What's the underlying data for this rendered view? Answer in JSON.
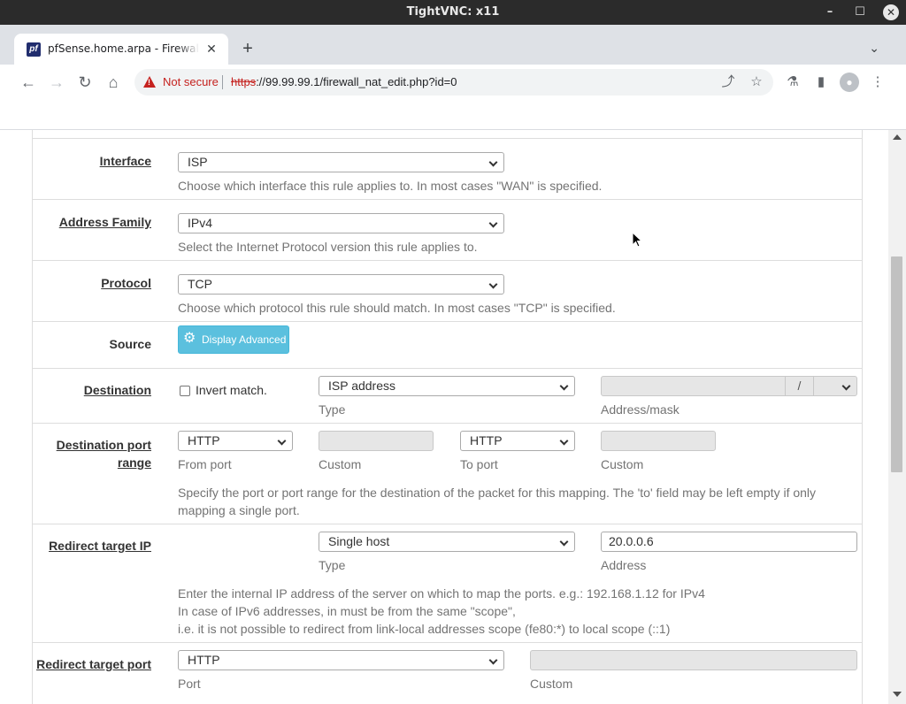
{
  "window": {
    "title": "TightVNC: x11",
    "minimize": "–",
    "maximize": "☐",
    "close": "✕"
  },
  "browser": {
    "tab_title": "pfSense.home.arpa - Firewall: NAT: Port Forward: Edit",
    "tab_close": "✕",
    "favicon_text": "pf",
    "new_tab": "+",
    "tab_menu": "⌄",
    "back": "←",
    "forward": "→",
    "reload": "↻",
    "home": "⌂",
    "security_label": "Not secure",
    "url_scheme": "https",
    "url_rest": "://99.99.99.1/firewall_nat_edit.php?id=0",
    "share": "⤴",
    "bookmark": "☆",
    "extensions": "⚗",
    "sidepanel": "▮",
    "profile": "●",
    "menu": "⋮"
  },
  "form": {
    "interface": {
      "label": "Interface",
      "value": "ISP",
      "help": "Choose which interface this rule applies to. In most cases \"WAN\" is specified."
    },
    "address_family": {
      "label": "Address Family",
      "value": "IPv4",
      "help": "Select the Internet Protocol version this rule applies to."
    },
    "protocol": {
      "label": "Protocol",
      "value": "TCP",
      "help": "Choose which protocol this rule should match. In most cases \"TCP\" is specified."
    },
    "source": {
      "label": "Source",
      "button": "Display Advanced"
    },
    "destination": {
      "label": "Destination",
      "invert": "Invert match.",
      "type_value": "ISP address",
      "type_label": "Type",
      "address_label": "Address/mask",
      "slash": "/"
    },
    "dest_port": {
      "label_line1": "Destination port",
      "label_line2": "range",
      "from_value": "HTTP",
      "from_label": "From port",
      "custom1_label": "Custom",
      "to_value": "HTTP",
      "to_label": "To port",
      "custom2_label": "Custom",
      "help_line1": "Specify the port or port range for the destination of the packet for this mapping. The 'to' field may be left empty if only",
      "help_line2": "mapping a single port."
    },
    "redirect_ip": {
      "label": "Redirect target IP",
      "type_value": "Single host",
      "type_label": "Type",
      "address_value": "20.0.0.6",
      "address_label": "Address",
      "help_line1": "Enter the internal IP address of the server on which to map the ports. e.g.: 192.168.1.12 for IPv4",
      "help_line2": "In case of IPv6 addresses, in must be from the same \"scope\",",
      "help_line3": "i.e. it is not possible to redirect from link-local addresses scope (fe80:*) to local scope (::1)"
    },
    "redirect_port": {
      "label": "Redirect target port",
      "port_value": "HTTP",
      "port_label": "Port",
      "custom_label": "Custom"
    }
  }
}
